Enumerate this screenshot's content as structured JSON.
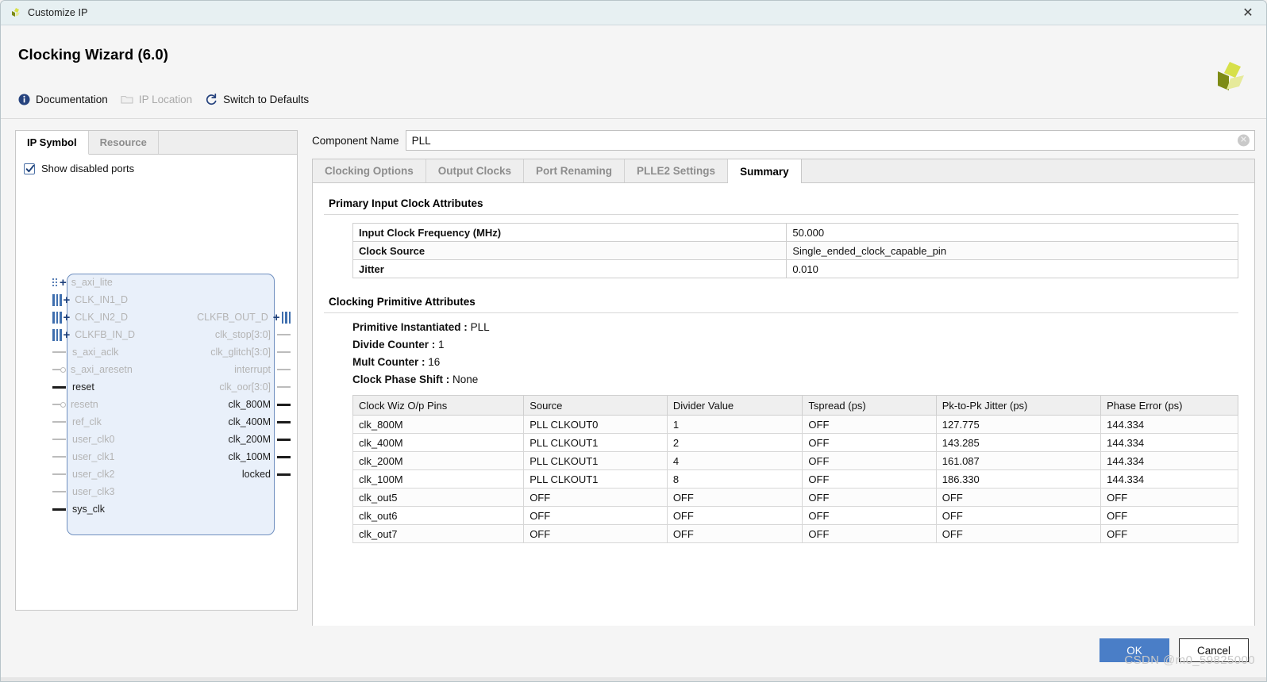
{
  "window": {
    "title": "Customize IP",
    "close_icon": "close-icon",
    "app_icon": "xilinx-logo-icon"
  },
  "header": {
    "title": "Clocking Wizard (6.0)",
    "logo": "xilinx-logo",
    "toolbar": [
      {
        "label": "Documentation",
        "icon": "info-icon",
        "disabled": false
      },
      {
        "label": "IP Location",
        "icon": "folder-icon",
        "disabled": true
      },
      {
        "label": "Switch to Defaults",
        "icon": "refresh-icon",
        "disabled": false
      }
    ]
  },
  "left_panel": {
    "tabs": [
      {
        "label": "IP Symbol",
        "active": true
      },
      {
        "label": "Resource",
        "active": false
      }
    ],
    "show_disabled_ports": {
      "label": "Show disabled ports",
      "checked": true
    },
    "symbol": {
      "inputs": [
        {
          "name": "s_axi_lite",
          "style": "group",
          "enabled": false,
          "conn": "busdot"
        },
        {
          "name": "CLK_IN1_D",
          "style": "group",
          "enabled": false,
          "conn": "bus3"
        },
        {
          "name": "CLK_IN2_D",
          "style": "group",
          "enabled": false,
          "conn": "bus3"
        },
        {
          "name": "CLKFB_IN_D",
          "style": "group",
          "enabled": false,
          "conn": "bus3"
        },
        {
          "name": "s_axi_aclk",
          "style": "pin",
          "enabled": false,
          "conn": "stub"
        },
        {
          "name": "s_axi_aresetn",
          "style": "pin",
          "enabled": false,
          "conn": "stub-n"
        },
        {
          "name": "reset",
          "style": "pin",
          "enabled": true,
          "conn": "stub"
        },
        {
          "name": "resetn",
          "style": "pin",
          "enabled": false,
          "conn": "stub-n"
        },
        {
          "name": "ref_clk",
          "style": "pin",
          "enabled": false,
          "conn": "stub"
        },
        {
          "name": "user_clk0",
          "style": "pin",
          "enabled": false,
          "conn": "stub"
        },
        {
          "name": "user_clk1",
          "style": "pin",
          "enabled": false,
          "conn": "stub"
        },
        {
          "name": "user_clk2",
          "style": "pin",
          "enabled": false,
          "conn": "stub"
        },
        {
          "name": "user_clk3",
          "style": "pin",
          "enabled": false,
          "conn": "stub"
        },
        {
          "name": "sys_clk",
          "style": "pin",
          "enabled": true,
          "conn": "stub"
        }
      ],
      "outputs": [
        {
          "name": "CLKFB_OUT_D",
          "style": "group",
          "enabled": false,
          "conn": "bus3",
          "row": 2
        },
        {
          "name": "clk_stop[3:0]",
          "style": "pin",
          "enabled": false,
          "conn": "stub",
          "row": 3
        },
        {
          "name": "clk_glitch[3:0]",
          "style": "pin",
          "enabled": false,
          "conn": "stub",
          "row": 4
        },
        {
          "name": "interrupt",
          "style": "pin",
          "enabled": false,
          "conn": "stub",
          "row": 5
        },
        {
          "name": "clk_oor[3:0]",
          "style": "pin",
          "enabled": false,
          "conn": "stub",
          "row": 6
        },
        {
          "name": "clk_800M",
          "style": "pin",
          "enabled": true,
          "conn": "stub",
          "row": 7
        },
        {
          "name": "clk_400M",
          "style": "pin",
          "enabled": true,
          "conn": "stub",
          "row": 8
        },
        {
          "name": "clk_200M",
          "style": "pin",
          "enabled": true,
          "conn": "stub",
          "row": 9
        },
        {
          "name": "clk_100M",
          "style": "pin",
          "enabled": true,
          "conn": "stub",
          "row": 10
        },
        {
          "name": "locked",
          "style": "pin",
          "enabled": true,
          "conn": "stub",
          "row": 11
        }
      ]
    }
  },
  "component_name": {
    "label": "Component Name",
    "value": "PLL",
    "placeholder": "",
    "clear_icon": "clear-circle-icon"
  },
  "tabs": [
    {
      "label": "Clocking Options",
      "active": false
    },
    {
      "label": "Output Clocks",
      "active": false
    },
    {
      "label": "Port Renaming",
      "active": false
    },
    {
      "label": "PLLE2 Settings",
      "active": false
    },
    {
      "label": "Summary",
      "active": true
    }
  ],
  "summary": {
    "primary_input_clock": {
      "title": "Primary Input Clock Attributes",
      "rows": [
        {
          "key": "Input Clock Frequency (MHz)",
          "value": "50.000"
        },
        {
          "key": "Clock Source",
          "value": "Single_ended_clock_capable_pin"
        },
        {
          "key": "Jitter",
          "value": "0.010"
        }
      ]
    },
    "clocking_primitive": {
      "title": "Clocking Primitive Attributes",
      "items": [
        {
          "key": "Primitive Instantiated :",
          "value": "PLL"
        },
        {
          "key": "Divide Counter :",
          "value": "1"
        },
        {
          "key": "Mult Counter :",
          "value": "16"
        },
        {
          "key": "Clock Phase Shift :",
          "value": "None"
        }
      ],
      "table": {
        "columns": [
          "Clock Wiz O/p Pins",
          "Source",
          "Divider Value",
          "Tspread (ps)",
          "Pk-to-Pk Jitter (ps)",
          "Phase Error (ps)"
        ],
        "rows": [
          [
            "clk_800M",
            "PLL CLKOUT0",
            "1",
            "OFF",
            "127.775",
            "144.334"
          ],
          [
            "clk_400M",
            "PLL CLKOUT1",
            "2",
            "OFF",
            "143.285",
            "144.334"
          ],
          [
            "clk_200M",
            "PLL CLKOUT1",
            "4",
            "OFF",
            "161.087",
            "144.334"
          ],
          [
            "clk_100M",
            "PLL CLKOUT1",
            "8",
            "OFF",
            "186.330",
            "144.334"
          ],
          [
            "clk_out5",
            "OFF",
            "OFF",
            "OFF",
            "OFF",
            "OFF"
          ],
          [
            "clk_out6",
            "OFF",
            "OFF",
            "OFF",
            "OFF",
            "OFF"
          ],
          [
            "clk_out7",
            "OFF",
            "OFF",
            "OFF",
            "OFF",
            "OFF"
          ]
        ]
      }
    }
  },
  "footer": {
    "ok_label": "OK",
    "cancel_label": "Cancel",
    "watermark": "CSDN @m0_59825000"
  },
  "colors": {
    "accent": "#4a7ec7",
    "symbol_fill": "#e9f0fa",
    "symbol_border": "#6f8fbf",
    "titlebar": "#e7f0f2",
    "logo_light": "#d7e04a",
    "logo_mid": "#e6ea9a",
    "logo_dark": "#7d8b14"
  }
}
